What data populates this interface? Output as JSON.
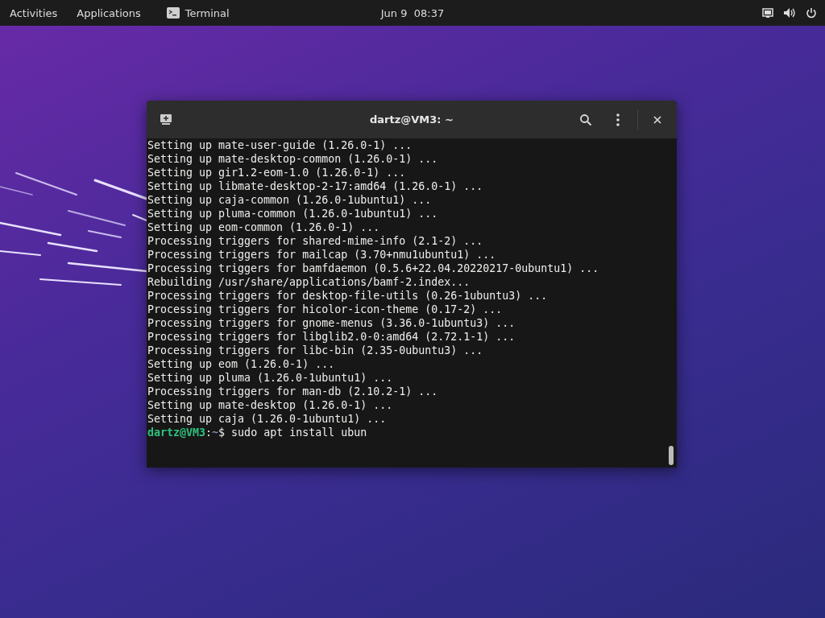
{
  "top_bar": {
    "activities": "Activities",
    "applications": "Applications",
    "app_name": "Terminal",
    "clock": "Jun 9  08:37"
  },
  "terminal": {
    "title": "dartz@VM3: ~",
    "lines": [
      "Setting up mate-user-guide (1.26.0-1) ...",
      "Setting up mate-desktop-common (1.26.0-1) ...",
      "Setting up gir1.2-eom-1.0 (1.26.0-1) ...",
      "Setting up libmate-desktop-2-17:amd64 (1.26.0-1) ...",
      "Setting up caja-common (1.26.0-1ubuntu1) ...",
      "Setting up pluma-common (1.26.0-1ubuntu1) ...",
      "Setting up eom-common (1.26.0-1) ...",
      "Processing triggers for shared-mime-info (2.1-2) ...",
      "Processing triggers for mailcap (3.70+nmu1ubuntu1) ...",
      "Processing triggers for bamfdaemon (0.5.6+22.04.20220217-0ubuntu1) ...",
      "Rebuilding /usr/share/applications/bamf-2.index...",
      "Processing triggers for desktop-file-utils (0.26-1ubuntu3) ...",
      "Processing triggers for hicolor-icon-theme (0.17-2) ...",
      "Processing triggers for gnome-menus (3.36.0-1ubuntu3) ...",
      "Processing triggers for libglib2.0-0:amd64 (2.72.1-1) ...",
      "Processing triggers for libc-bin (2.35-0ubuntu3) ...",
      "Setting up eom (1.26.0-1) ...",
      "Setting up pluma (1.26.0-1ubuntu1) ...",
      "Processing triggers for man-db (2.10.2-1) ...",
      "Setting up mate-desktop (1.26.0-1) ...",
      "Setting up caja (1.26.0-1ubuntu1) ..."
    ],
    "prompt": {
      "user_host": "dartz@VM3",
      "separator": ":",
      "path": "~",
      "symbol": "$",
      "command": "sudo apt install ubun"
    }
  }
}
